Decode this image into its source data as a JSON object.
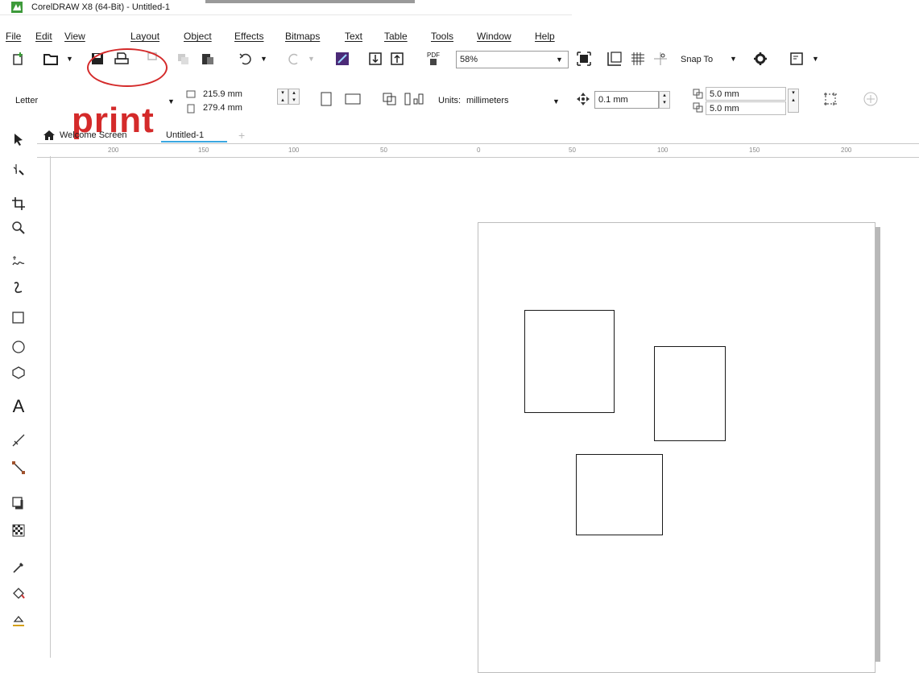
{
  "window": {
    "title": "CorelDRAW X8 (64-Bit) - Untitled-1"
  },
  "menu": [
    "File",
    "Edit",
    "View",
    "Layout",
    "Object",
    "Effects",
    "Bitmaps",
    "Text",
    "Table",
    "Tools",
    "Window",
    "Help"
  ],
  "toolbar": {
    "zoom_value": "58%",
    "snap_to_label": "Snap To",
    "pdf_label": "PDF"
  },
  "property_bar": {
    "page_size": "Letter",
    "width": "215.9 mm",
    "height": "279.4 mm",
    "units_label": "Units:",
    "units_value": "millimeters",
    "nudge": "0.1 mm",
    "dup_x": "5.0 mm",
    "dup_y": "5.0 mm"
  },
  "tabs": [
    {
      "label": "Welcome Screen",
      "active": false
    },
    {
      "label": "Untitled-1",
      "active": true
    }
  ],
  "ruler": {
    "h_ticks": [
      "200",
      "150",
      "100",
      "50",
      "0",
      "50",
      "100",
      "150",
      "200"
    ]
  },
  "annotation": {
    "label": "print",
    "color": "#d42a2a"
  },
  "accent_color": "#3aa7e0"
}
